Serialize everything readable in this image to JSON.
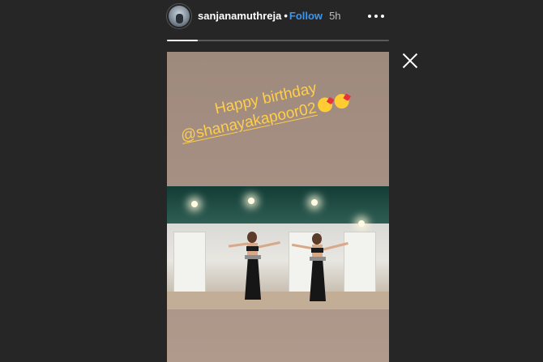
{
  "header": {
    "username": "sanjanamuthreja",
    "separator": "•",
    "follow_label": "Follow",
    "time_ago": "5h",
    "more_icon": "more-horizontal-icon"
  },
  "progress": {
    "segments": 1,
    "fraction_complete": 0.14
  },
  "close_icon": "close-icon",
  "story": {
    "caption_line1": "Happy birthday",
    "caption_mention": "@shanayakapoor02",
    "emoji_icons": [
      "kissing-face-with-heart-emoji",
      "kissing-face-with-heart-emoji"
    ]
  },
  "colors": {
    "background": "#262626",
    "follow_blue": "#3897f0",
    "caption_yellow": "#ffce4a",
    "story_bg": "#a69083"
  }
}
